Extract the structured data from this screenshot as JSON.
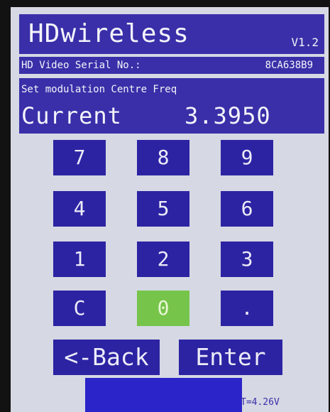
{
  "header": {
    "title": "HDwireless",
    "version": "V1.2"
  },
  "serial": {
    "label": "HD Video Serial No.:",
    "value": "8CA638B9"
  },
  "frequency": {
    "mode_label": "Set modulation Centre Freq",
    "current_label": "Current",
    "current_value": "3.3950"
  },
  "keypad": {
    "rows": [
      [
        "7",
        "8",
        "9"
      ],
      [
        "4",
        "5",
        "6"
      ],
      [
        "1",
        "2",
        "3"
      ],
      [
        "C",
        "0",
        "."
      ]
    ],
    "selected_key": "0",
    "selected_color": "#76c44a",
    "key_color": "#2c23a3"
  },
  "actions": {
    "back_label": "<-Back",
    "enter_label": "Enter"
  },
  "status": {
    "voltage": "T=4.26V"
  },
  "colors": {
    "screen_background": "#d6d8e4",
    "bar": "#3a2fa8",
    "footer": "#2b24c9"
  }
}
